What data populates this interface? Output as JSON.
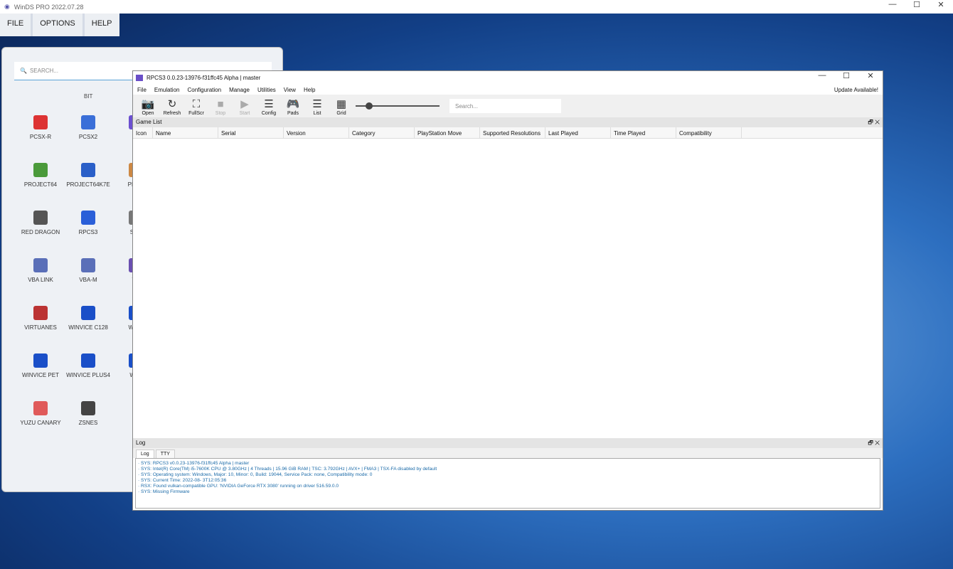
{
  "os_window": {
    "title": "WinDS PRO 2022.07.28",
    "controls": [
      "—",
      "☐",
      "✕"
    ]
  },
  "launcher_menu": [
    "FILE",
    "OPTIONS",
    "HELP"
  ],
  "launcher": {
    "search_placeholder": "SEARCH...",
    "section": "BIT",
    "items": [
      {
        "label": "PCSX-R",
        "color": "#d33"
      },
      {
        "label": "PCSX2",
        "color": "#3a6fd8"
      },
      {
        "label": "P",
        "color": "#6b4fd0"
      },
      {
        "label": "PROJECT64",
        "color": "#4a9a3a"
      },
      {
        "label": "PROJECT64K7E",
        "color": "#2a5fc8"
      },
      {
        "label": "PROS",
        "color": "#c84"
      },
      {
        "label": "RED DRAGON",
        "color": "#555"
      },
      {
        "label": "RPCS3",
        "color": "#2a5fd8"
      },
      {
        "label": "SNE",
        "color": "#777"
      },
      {
        "label": "VBA LINK",
        "color": "#5a6fb8"
      },
      {
        "label": "VBA-M",
        "color": "#5a6fb8"
      },
      {
        "label": "VB",
        "color": "#6a4fb0"
      },
      {
        "label": "VIRTUANES",
        "color": "#b33"
      },
      {
        "label": "WINVICE C128",
        "color": "#1a4fc8"
      },
      {
        "label": "WINV",
        "color": "#1a4fc8"
      },
      {
        "label": "WINVICE PET",
        "color": "#1a4fc8"
      },
      {
        "label": "WINVICE PLUS4",
        "color": "#1a4fc8"
      },
      {
        "label": "WI V",
        "color": "#1a4fc8"
      },
      {
        "label": "YUZU CANARY",
        "color": "#e05a5a"
      },
      {
        "label": "ZSNES",
        "color": "#444"
      }
    ]
  },
  "rpcs3": {
    "title": "RPCS3 0.0.23-13976-f31ffc45 Alpha | master",
    "controls": [
      "—",
      "☐",
      "✕"
    ],
    "menu": [
      "File",
      "Emulation",
      "Configuration",
      "Manage",
      "Utilities",
      "View",
      "Help"
    ],
    "update": "Update Available!",
    "toolbar": [
      {
        "label": "Open",
        "glyph": "📷",
        "enabled": true
      },
      {
        "label": "Refresh",
        "glyph": "↻",
        "enabled": true
      },
      {
        "label": "FullScr",
        "glyph": "⛶",
        "enabled": true
      },
      {
        "label": "Stop",
        "glyph": "■",
        "enabled": false
      },
      {
        "label": "Start",
        "glyph": "▶",
        "enabled": false
      },
      {
        "label": "Config",
        "glyph": "☰",
        "enabled": true
      },
      {
        "label": "Pads",
        "glyph": "🎮",
        "enabled": true
      },
      {
        "label": "List",
        "glyph": "☰",
        "enabled": true
      },
      {
        "label": "Grid",
        "glyph": "▦",
        "enabled": true
      }
    ],
    "search_placeholder": "Search...",
    "game_list_title": "Game List",
    "columns": [
      "Icon",
      "Name",
      "Serial",
      "Version",
      "Category",
      "PlayStation Move",
      "Supported Resolutions",
      "Last Played",
      "Time Played",
      "Compatibility"
    ],
    "log_title": "Log",
    "log_tabs": [
      "Log",
      "TTY"
    ],
    "log_lines": [
      "· SYS: RPCS3 v0.0.23-13976-f31ffc45 Alpha | master",
      "· SYS: Intel(R) Core(TM) i5-7600K CPU @ 3.80GHz | 4 Threads | 15.96 GiB RAM | TSC: 3.792GHz | AVX+ | FMA3 | TSX-FA disabled by default",
      "· SYS: Operating system: Windows, Major: 10, Minor: 0, Build: 19044, Service Pack: none, Compatibility mode: 0",
      "· SYS: Current Time: 2022-08- 3T12:05:36",
      "· RSX: Found vulkan-compatible GPU: 'NVIDIA GeForce RTX 3080' running on driver 516.59.0.0",
      "· SYS: Missing Firmware"
    ],
    "dock_controls": "🗗 ✕"
  }
}
